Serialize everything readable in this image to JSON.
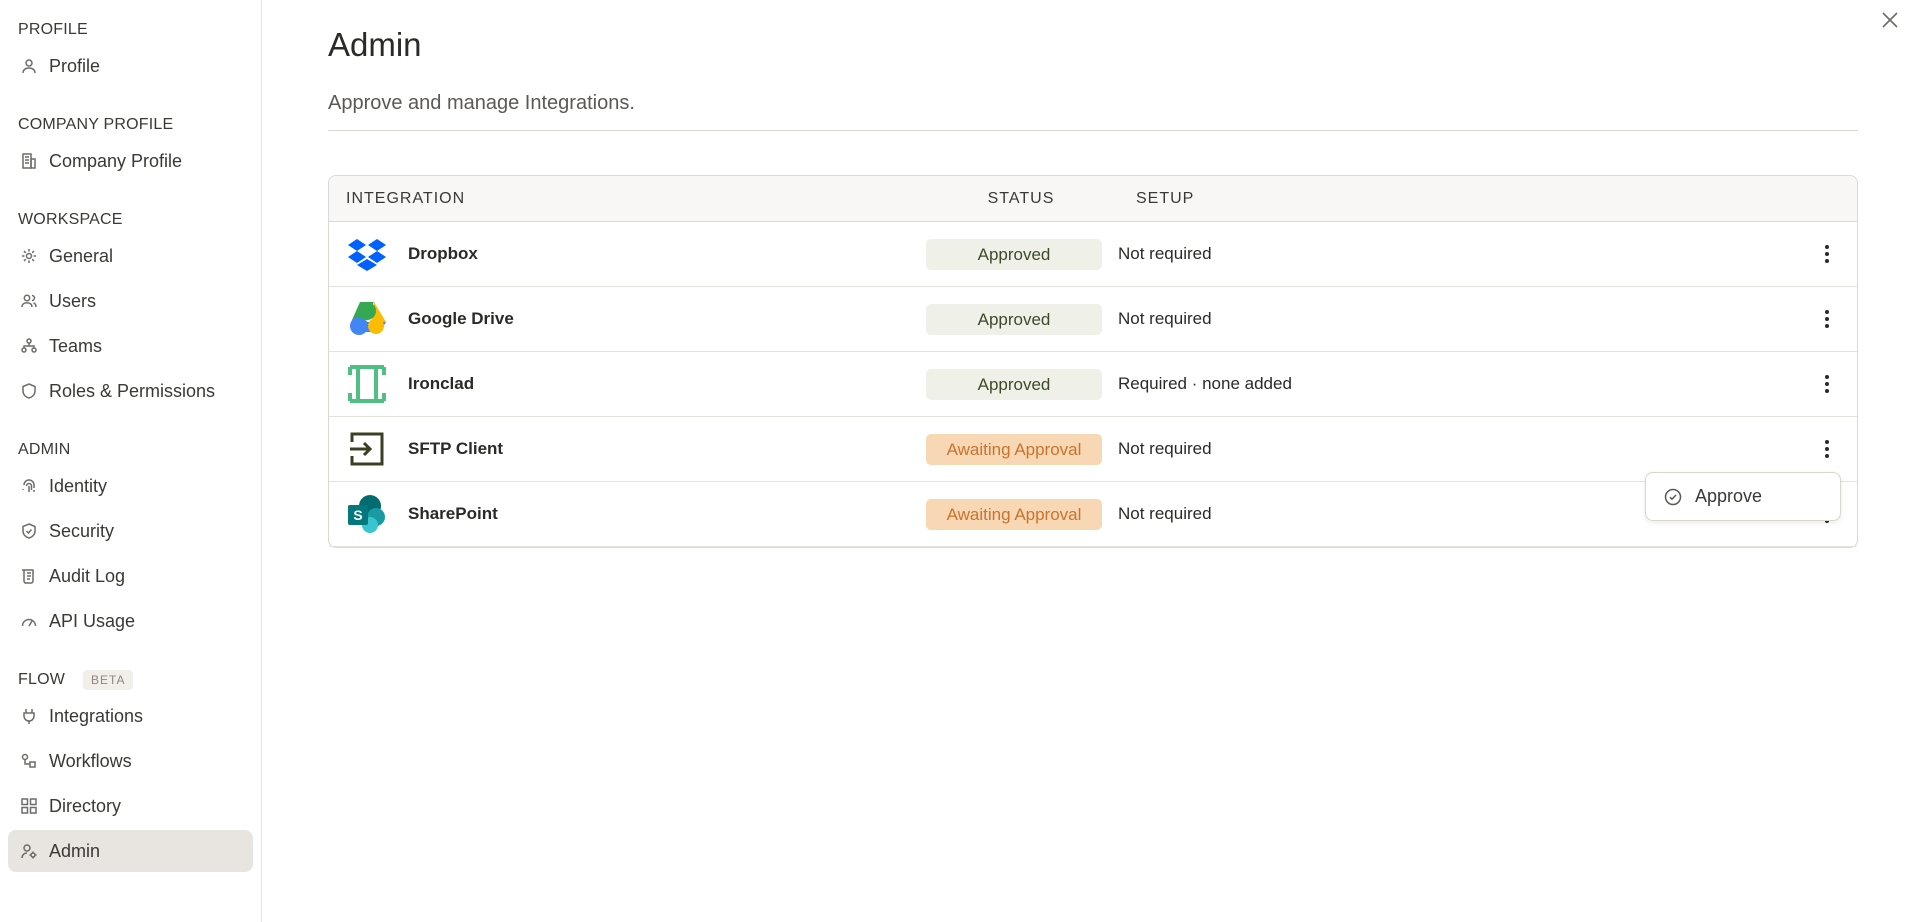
{
  "sidebar": {
    "sections": [
      {
        "title": "PROFILE",
        "items": [
          {
            "label": "Profile",
            "icon": "user-icon"
          }
        ]
      },
      {
        "title": "COMPANY PROFILE",
        "items": [
          {
            "label": "Company Profile",
            "icon": "building-icon"
          }
        ]
      },
      {
        "title": "WORKSPACE",
        "items": [
          {
            "label": "General",
            "icon": "gear-icon"
          },
          {
            "label": "Users",
            "icon": "users-icon"
          },
          {
            "label": "Teams",
            "icon": "teams-icon"
          },
          {
            "label": "Roles & Permissions",
            "icon": "shield-icon"
          }
        ]
      },
      {
        "title": "ADMIN",
        "items": [
          {
            "label": "Identity",
            "icon": "fingerprint-icon"
          },
          {
            "label": "Security",
            "icon": "shield-check-icon"
          },
          {
            "label": "Audit Log",
            "icon": "scroll-icon"
          },
          {
            "label": "API Usage",
            "icon": "gauge-icon"
          }
        ]
      },
      {
        "title": "FLOW",
        "badge": "BETA",
        "items": [
          {
            "label": "Integrations",
            "icon": "plug-icon"
          },
          {
            "label": "Workflows",
            "icon": "workflow-icon"
          },
          {
            "label": "Directory",
            "icon": "grid-icon"
          },
          {
            "label": "Admin",
            "icon": "user-gear-icon",
            "active": true
          }
        ]
      }
    ]
  },
  "main": {
    "title": "Admin",
    "subtitle": "Approve and manage Integrations.",
    "table": {
      "headers": {
        "integration": "INTEGRATION",
        "status": "STATUS",
        "setup": "SETUP"
      },
      "rows": [
        {
          "name": "Dropbox",
          "logo": "dropbox-logo-icon",
          "status": "Approved",
          "status_kind": "approved",
          "setup": "Not required"
        },
        {
          "name": "Google Drive",
          "logo": "google-drive-logo-icon",
          "status": "Approved",
          "status_kind": "approved",
          "setup": "Not required"
        },
        {
          "name": "Ironclad",
          "logo": "ironclad-logo-icon",
          "status": "Approved",
          "status_kind": "approved",
          "setup": "Required · none added"
        },
        {
          "name": "SFTP Client",
          "logo": "sftp-logo-icon",
          "status": "Awaiting Approval",
          "status_kind": "awaiting",
          "setup": "Not required"
        },
        {
          "name": "SharePoint",
          "logo": "sharepoint-logo-icon",
          "status": "Awaiting Approval",
          "status_kind": "awaiting",
          "setup": "Not required"
        }
      ]
    },
    "row_menu": {
      "label": "Approve",
      "icon": "check-circle-icon"
    }
  },
  "colors": {
    "approved_bg": "#eff1e8",
    "approved_text": "#3d4a2a",
    "awaiting_bg": "#f8d7b4",
    "awaiting_text": "#c8742e",
    "active_nav_bg": "#e8e4df"
  }
}
